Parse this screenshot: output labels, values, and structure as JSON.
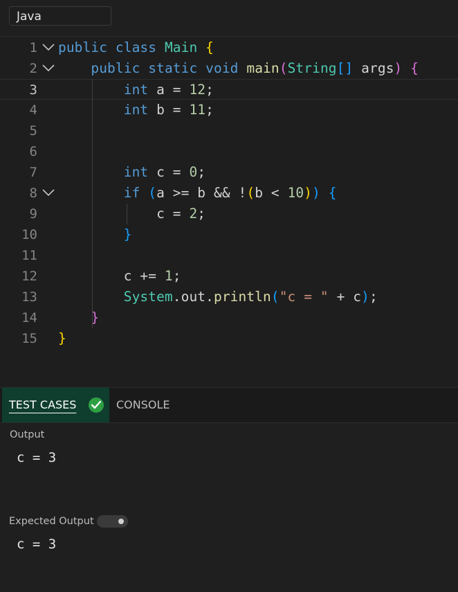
{
  "language": {
    "selected": "Java"
  },
  "editor": {
    "line_numbers": [
      "1",
      "2",
      "3",
      "4",
      "5",
      "6",
      "7",
      "8",
      "9",
      "10",
      "11",
      "12",
      "13",
      "14",
      "15"
    ],
    "active_line": "3",
    "lines": [
      {
        "tokens": [
          [
            "kw",
            "public"
          ],
          [
            "plain",
            " "
          ],
          [
            "kw",
            "class"
          ],
          [
            "plain",
            " "
          ],
          [
            "ty",
            "Main"
          ],
          [
            "plain",
            " "
          ],
          [
            "b1",
            "{"
          ]
        ]
      },
      {
        "tokens": [
          [
            "plain",
            "    "
          ],
          [
            "kw",
            "public"
          ],
          [
            "plain",
            " "
          ],
          [
            "kw",
            "static"
          ],
          [
            "plain",
            " "
          ],
          [
            "kw",
            "void"
          ],
          [
            "plain",
            " "
          ],
          [
            "fn",
            "main"
          ],
          [
            "b2",
            "("
          ],
          [
            "ty",
            "String"
          ],
          [
            "b3",
            "[]"
          ],
          [
            "plain",
            " args"
          ],
          [
            "b2",
            ")"
          ],
          [
            "plain",
            " "
          ],
          [
            "b2",
            "{"
          ]
        ]
      },
      {
        "tokens": [
          [
            "plain",
            "        "
          ],
          [
            "kw",
            "int"
          ],
          [
            "plain",
            " a = "
          ],
          [
            "num",
            "12"
          ],
          [
            "plain",
            ";"
          ]
        ]
      },
      {
        "tokens": [
          [
            "plain",
            "        "
          ],
          [
            "kw",
            "int"
          ],
          [
            "plain",
            " b = "
          ],
          [
            "num",
            "11"
          ],
          [
            "plain",
            ";"
          ]
        ]
      },
      {
        "tokens": []
      },
      {
        "tokens": []
      },
      {
        "tokens": [
          [
            "plain",
            "        "
          ],
          [
            "kw",
            "int"
          ],
          [
            "plain",
            " c = "
          ],
          [
            "num",
            "0"
          ],
          [
            "plain",
            ";"
          ]
        ]
      },
      {
        "tokens": [
          [
            "plain",
            "        "
          ],
          [
            "kw",
            "if"
          ],
          [
            "plain",
            " "
          ],
          [
            "b3",
            "("
          ],
          [
            "plain",
            "a >= b && !"
          ],
          [
            "b1",
            "("
          ],
          [
            "plain",
            "b < "
          ],
          [
            "num",
            "10"
          ],
          [
            "b1",
            ")"
          ],
          [
            "b3",
            ")"
          ],
          [
            "plain",
            " "
          ],
          [
            "b3",
            "{"
          ]
        ]
      },
      {
        "tokens": [
          [
            "plain",
            "            c = "
          ],
          [
            "num",
            "2"
          ],
          [
            "plain",
            ";"
          ]
        ]
      },
      {
        "tokens": [
          [
            "plain",
            "        "
          ],
          [
            "b3",
            "}"
          ]
        ]
      },
      {
        "tokens": []
      },
      {
        "tokens": [
          [
            "plain",
            "        c += "
          ],
          [
            "num",
            "1"
          ],
          [
            "plain",
            ";"
          ]
        ]
      },
      {
        "tokens": [
          [
            "plain",
            "        "
          ],
          [
            "ty",
            "System"
          ],
          [
            "plain",
            ".out."
          ],
          [
            "fn",
            "println"
          ],
          [
            "b3",
            "("
          ],
          [
            "str",
            "\"c = \""
          ],
          [
            "plain",
            " + c"
          ],
          [
            "b3",
            ")"
          ],
          [
            "plain",
            ";"
          ]
        ]
      },
      {
        "tokens": [
          [
            "plain",
            "    "
          ],
          [
            "b2",
            "}"
          ]
        ]
      },
      {
        "tokens": [
          [
            "b1",
            "}"
          ]
        ]
      }
    ]
  },
  "panel": {
    "tabs": {
      "test_cases": "TEST CASES",
      "console": "CONSOLE"
    },
    "output_label": "Output",
    "output_value": "c = 3",
    "expected_label": "Expected Output",
    "expected_value": "c = 3"
  }
}
